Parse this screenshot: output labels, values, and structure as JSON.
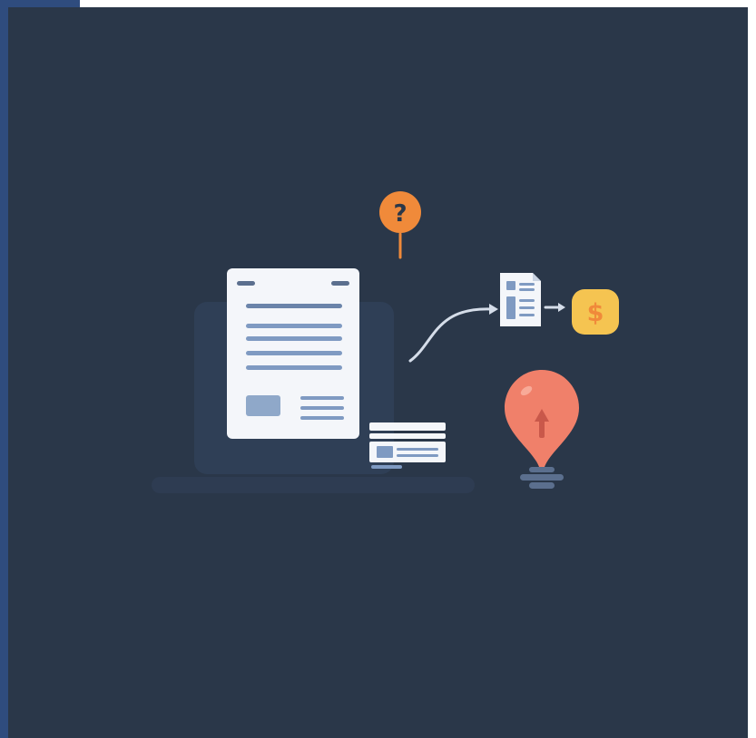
{
  "illustration": {
    "icons": [
      "laptop-icon",
      "document-icon",
      "question-mark-icon",
      "invoice-icon",
      "dollar-coin-icon",
      "lightbulb-icon",
      "receipt-card-icon"
    ],
    "question_symbol": "?",
    "dollar_symbol": "$",
    "colors": {
      "background": "#2a3749",
      "frame_accent": "#2f4c7e",
      "paper": "#f4f6fa",
      "text_lines": "#7f9ac2",
      "orange": "#f08a3a",
      "coin": "#f5c451",
      "bulb": "#f0806a"
    }
  }
}
